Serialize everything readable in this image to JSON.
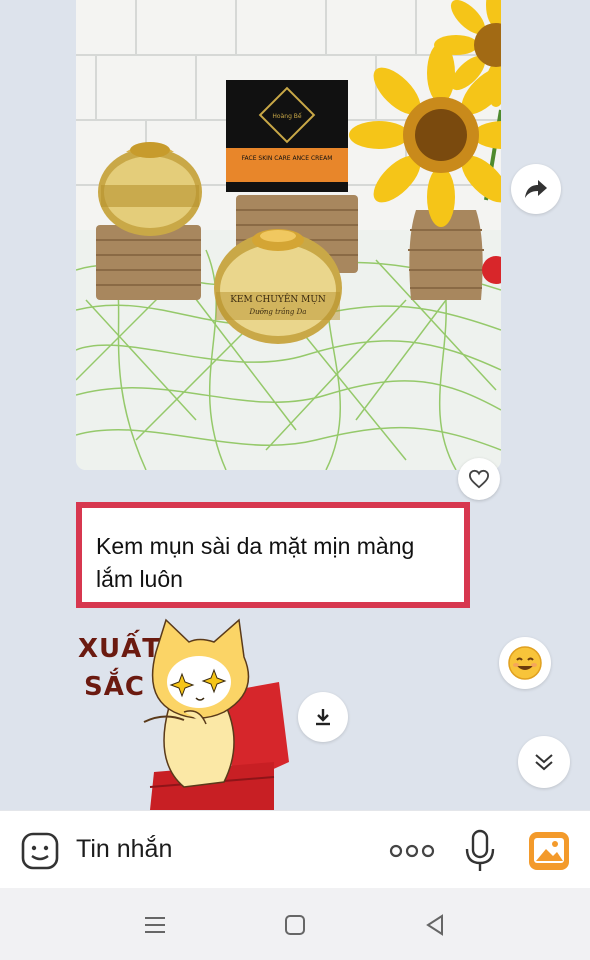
{
  "message": {
    "text_line1": "Kem mụn sài da mặt mịn màng",
    "text_line2": "lắm luôn"
  },
  "product": {
    "box_brand": "Hoàng Bế",
    "box_label": "FACE SKIN CARE ANCE CREAM",
    "jar_label_line1": "KEM CHUYÊN MỤN",
    "jar_label_line2": "Dưỡng trắng Da"
  },
  "sticker": {
    "line1": "XUẤT",
    "line2": "SẮC"
  },
  "input_bar": {
    "placeholder": "Tin nhắn"
  },
  "icons": {
    "heart": "heart-icon",
    "share": "share-icon",
    "reaction": "smile-emoji-icon",
    "download": "download-icon",
    "scroll_down": "double-chevron-down-icon",
    "sticker": "sticker-icon",
    "more": "more-dots-icon",
    "mic": "microphone-icon",
    "image": "image-icon"
  },
  "colors": {
    "chat_background": "#dde3ec",
    "highlight_border": "#d7374f",
    "accent_orange": "#f39a2b"
  }
}
